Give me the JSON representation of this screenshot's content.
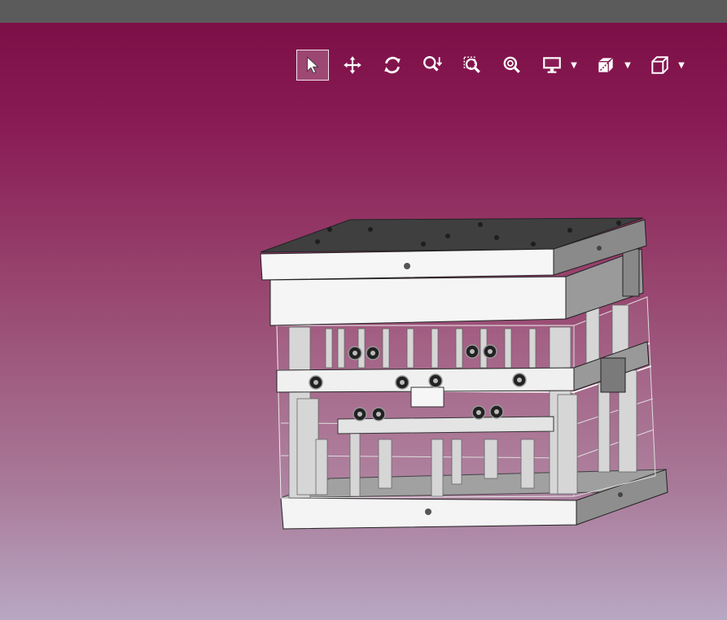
{
  "window": {
    "title": ""
  },
  "toolbar": {
    "active_tool": "select",
    "tools": [
      {
        "name": "select",
        "icon": "arrow-pointer-icon"
      },
      {
        "name": "pan",
        "icon": "move-arrows-icon"
      },
      {
        "name": "rotate",
        "icon": "rotate-icon"
      },
      {
        "name": "zoom",
        "icon": "zoom-in-out-icon"
      },
      {
        "name": "zoom-window",
        "icon": "zoom-window-icon"
      },
      {
        "name": "zoom-fit",
        "icon": "zoom-fit-icon"
      }
    ],
    "dropdowns": [
      {
        "name": "display",
        "icon": "monitor-icon"
      },
      {
        "name": "section",
        "icon": "section-plane-icon"
      },
      {
        "name": "view",
        "icon": "view-cube-icon"
      }
    ]
  },
  "colors": {
    "background_top": "#7d0f47",
    "background_bottom": "#b8a8c3",
    "title_bar": "#5b5b5b",
    "plate_face": "#f2f2f2",
    "plate_side": "#8c8c8c",
    "plate_top": "#4a4a4a"
  },
  "scene": {
    "model": "injection-mold-assembly"
  }
}
